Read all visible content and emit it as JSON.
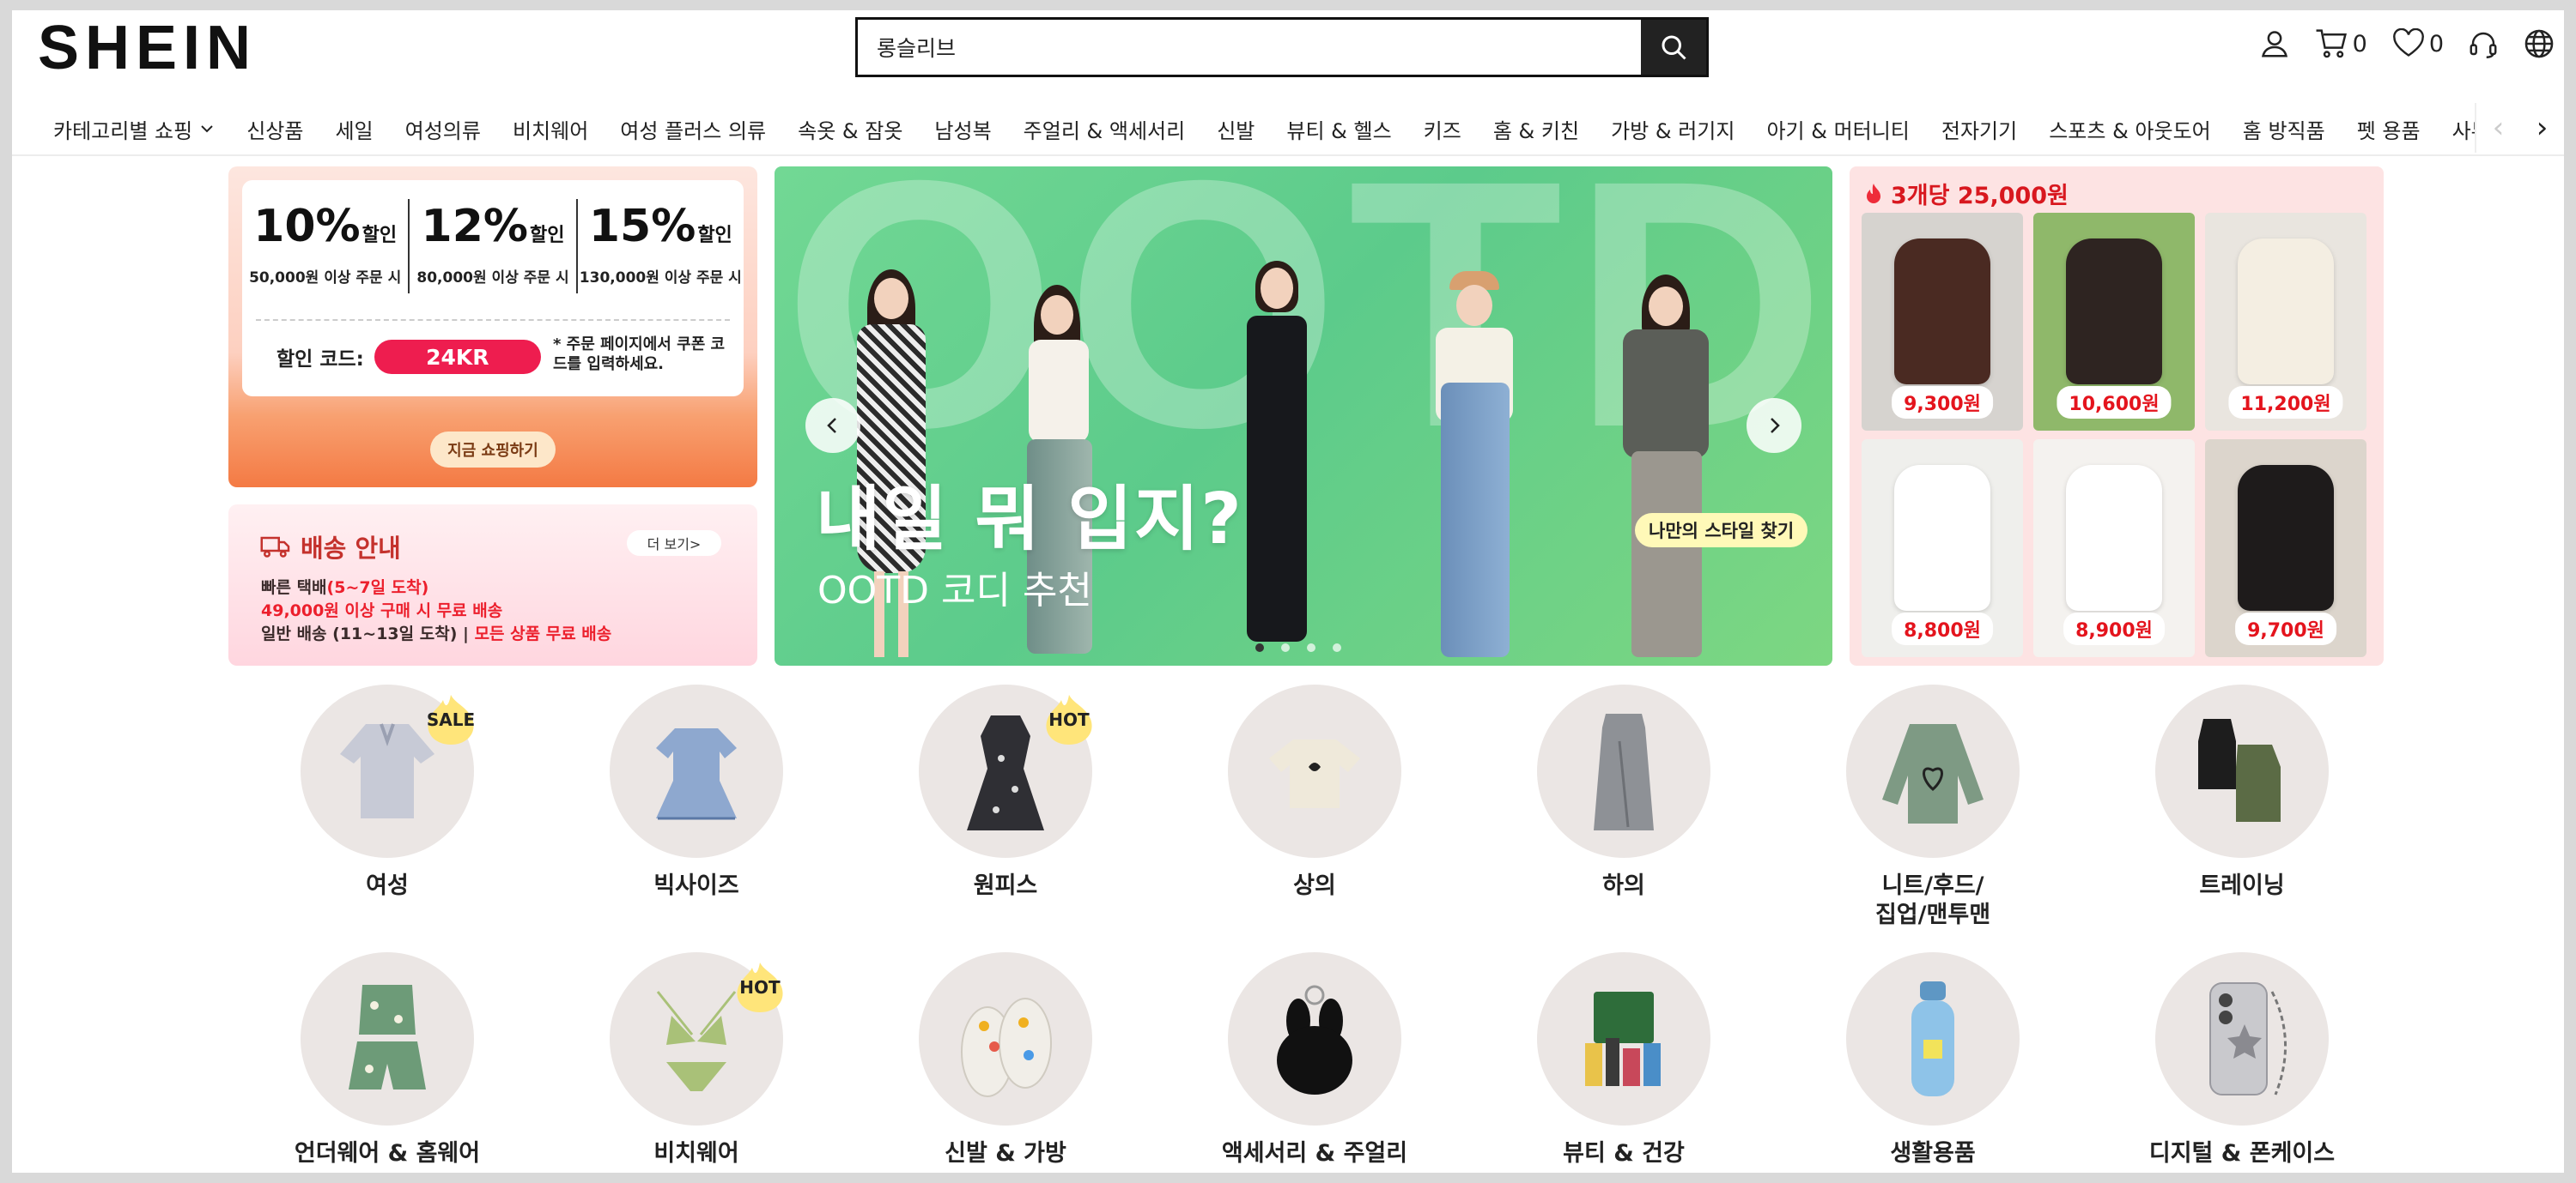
{
  "header": {
    "logo": "SHEIN",
    "search_value": "롱슬리브",
    "cart_count": "0",
    "wishlist_count": "0"
  },
  "nav": {
    "items": [
      "카테고리별 쇼핑",
      "신상품",
      "세일",
      "여성의류",
      "비치웨어",
      "여성 플러스 의류",
      "속옷 & 잠옷",
      "남성복",
      "주얼리 & 액세서리",
      "신발",
      "뷰티 & 헬스",
      "키즈",
      "홈 & 키친",
      "가방 & 러기지",
      "아기 & 머터니티",
      "전자기기",
      "스포츠 & 아웃도어",
      "홈 방직품",
      "펫 용품",
      "사무 & 학용품"
    ]
  },
  "promo": {
    "tiers": [
      {
        "pct": "10%",
        "unit": "할인",
        "cond": "50,000원 이상 주문 시"
      },
      {
        "pct": "12%",
        "unit": "할인",
        "cond": "80,000원 이상 주문 시"
      },
      {
        "pct": "15%",
        "unit": "할인",
        "cond": "130,000원 이상 주문 시"
      }
    ],
    "code_label": "할인 코드:",
    "code": "24KR",
    "note": "* 주문 페이지에서 쿠폰 코드를 입력하세요.",
    "cta": "지금 쇼핑하기"
  },
  "shipping": {
    "title": "배송 안내",
    "more": "더 보기>",
    "line1_a": "빠른 택배",
    "line1_b": "(5~7일 도착)",
    "line2": "49,000원 이상 구매 시 무료 배송",
    "line3_a": "일반 배송 (11~13일 도착)",
    "line3_sep": "|",
    "line3_b": "모든 상품 무료 배송"
  },
  "banner": {
    "bg_text": "OOTD",
    "title": "내일 뭐 입지?",
    "subtitle": "OOTD 코디 추천",
    "tag": "나만의 스타일 찾기",
    "slides": 4,
    "active_slide": 1
  },
  "deal": {
    "title": "3개당 25,000원",
    "items": [
      {
        "price": "9,300원",
        "bg": "#d6d3cf",
        "color": "#4a2a22"
      },
      {
        "price": "10,600원",
        "bg": "#8fb86a",
        "color": "#2e2421"
      },
      {
        "price": "11,200원",
        "bg": "#e9e5df",
        "color": "#f4eee2"
      },
      {
        "price": "8,800원",
        "bg": "#efefec",
        "color": "#ffffff"
      },
      {
        "price": "8,900원",
        "bg": "#f4f2ef",
        "color": "#ffffff"
      },
      {
        "price": "9,700원",
        "bg": "#dcd5cc",
        "color": "#1e1b1b"
      }
    ]
  },
  "categories": [
    {
      "label": "여성",
      "badge": "SALE",
      "kind": "blouse",
      "color": "#c7cad6"
    },
    {
      "label": "빅사이즈",
      "badge": "",
      "kind": "peplum",
      "color": "#8ea8cf"
    },
    {
      "label": "원피스",
      "badge": "HOT",
      "kind": "dress",
      "color": "#2f2f34"
    },
    {
      "label": "상의",
      "badge": "",
      "kind": "tee",
      "color": "#efe9da"
    },
    {
      "label": "하의",
      "badge": "",
      "kind": "skirt",
      "color": "#8e9196"
    },
    {
      "label": "니트/후드/\n집업/맨투맨",
      "badge": "",
      "kind": "sweater",
      "color": "#7e9a84"
    },
    {
      "label": "트레이닝",
      "badge": "",
      "kind": "tanks",
      "color": "#5b6b45"
    },
    {
      "label": "언더웨어 & 홈웨어",
      "badge": "",
      "kind": "pajama",
      "color": "#6d9b78"
    },
    {
      "label": "비치웨어",
      "badge": "HOT",
      "kind": "bikini",
      "color": "#a9c178"
    },
    {
      "label": "신발 & 가방",
      "badge": "",
      "kind": "clogs",
      "color": "#f1eee8"
    },
    {
      "label": "액세서리 & 주얼리",
      "badge": "",
      "kind": "plush",
      "color": "#111111"
    },
    {
      "label": "뷰티 & 건강",
      "badge": "",
      "kind": "beauty",
      "color": "#2e6d3a"
    },
    {
      "label": "생활용품",
      "badge": "",
      "kind": "bottle",
      "color": "#8ec3e8"
    },
    {
      "label": "디지털 & 폰케이스",
      "badge": "",
      "kind": "phone",
      "color": "#c9c9cd"
    }
  ]
}
